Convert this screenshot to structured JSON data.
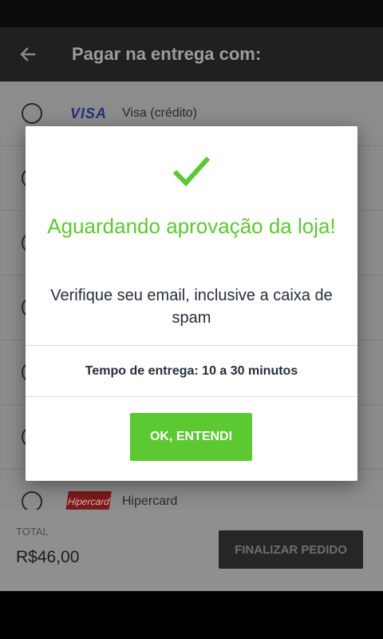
{
  "app_bar": {
    "title": "Pagar na entrega com:"
  },
  "payment_options": [
    {
      "label": "Visa (crédito)",
      "logo_text": "VISA",
      "icon": "visa-logo"
    },
    {
      "label": "",
      "icon": "card-logo"
    },
    {
      "label": "",
      "icon": "card-logo"
    },
    {
      "label": "",
      "icon": "card-logo"
    },
    {
      "label": "",
      "icon": "card-logo"
    },
    {
      "label": "",
      "icon": "card-logo"
    },
    {
      "label": "Hipercard",
      "logo_text": "Hipercard",
      "icon": "hipercard-logo"
    }
  ],
  "footer": {
    "total_label": "TOTAL",
    "total_value": "R$46,00",
    "finalize_label": "FINALIZAR PEDIDO"
  },
  "dialog": {
    "title": "Aguardando aprovação da loja!",
    "message": "Verifique seu email, inclusive a caixa de spam",
    "delivery_time": "Tempo de entrega: 10 a 30 minutos",
    "ok_label": "OK, ENTENDI"
  },
  "colors": {
    "accent_green": "#5cc832",
    "dialog_text": "#262f3a"
  }
}
